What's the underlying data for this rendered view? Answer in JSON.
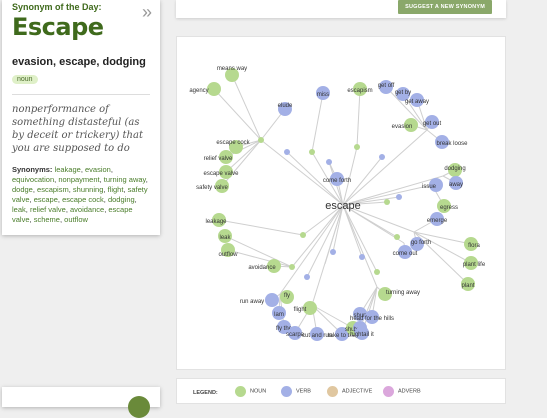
{
  "card": {
    "label": "Synonym of the Day:",
    "word": "Escape",
    "synonyms_line": "evasion, escape, dodging",
    "pos": "noun",
    "definition": "nonperformance of something distasteful (as by deceit or trickery) that you are supposed to do",
    "synonyms_heading": "Synonyms:",
    "synonyms": [
      "leakage",
      "evasion",
      "equivocation",
      "nonpayment",
      "turning away",
      "dodge",
      "escapism",
      "shunning",
      "flight",
      "safety valve",
      "escape",
      "escape cock",
      "dodging",
      "leak",
      "relief valve",
      "avoidance",
      "escape valve",
      "scheme",
      "outflow"
    ]
  },
  "top_panel": {
    "suggest_label": "SUGGEST A NEW SYNONYM"
  },
  "graph": {
    "colors": {
      "noun": "#b6d98f",
      "verb": "#a3b0e6",
      "adjective": "#e0c7a0",
      "adverb": "#dba7dc",
      "edge": "#cfcfcf",
      "hub": "#d2e4b6"
    },
    "center": "escape",
    "hubs": [
      "come forth",
      "escape",
      "evasion",
      "dodging",
      "issue",
      "come out",
      "go forth",
      "avoidance",
      "turning away",
      "flight",
      "run away"
    ],
    "nodes": [
      {
        "label": "means way",
        "pos": "noun"
      },
      {
        "label": "agency",
        "pos": "noun"
      },
      {
        "label": "elude",
        "pos": "verb"
      },
      {
        "label": "miss",
        "pos": "verb"
      },
      {
        "label": "escapism",
        "pos": "noun"
      },
      {
        "label": "get off",
        "pos": "verb"
      },
      {
        "label": "get by",
        "pos": "verb"
      },
      {
        "label": "get away",
        "pos": "verb"
      },
      {
        "label": "evasion",
        "pos": "noun"
      },
      {
        "label": "get out",
        "pos": "verb"
      },
      {
        "label": "break loose",
        "pos": "verb"
      },
      {
        "label": "escape cock",
        "pos": "noun"
      },
      {
        "label": "relief valve",
        "pos": "noun"
      },
      {
        "label": "escape valve",
        "pos": "noun"
      },
      {
        "label": "safety valve",
        "pos": "noun"
      },
      {
        "label": "come forth",
        "pos": "verb"
      },
      {
        "label": "dodging",
        "pos": "noun"
      },
      {
        "label": "issue",
        "pos": "verb"
      },
      {
        "label": "away",
        "pos": "verb"
      },
      {
        "label": "egress",
        "pos": "noun"
      },
      {
        "label": "emerge",
        "pos": "verb"
      },
      {
        "label": "leakage",
        "pos": "noun"
      },
      {
        "label": "leak",
        "pos": "noun"
      },
      {
        "label": "outflow",
        "pos": "noun"
      },
      {
        "label": "go forth",
        "pos": "verb"
      },
      {
        "label": "come out",
        "pos": "verb"
      },
      {
        "label": "flora",
        "pos": "noun"
      },
      {
        "label": "plant life",
        "pos": "noun"
      },
      {
        "label": "plant",
        "pos": "noun"
      },
      {
        "label": "avoidance",
        "pos": "noun"
      },
      {
        "label": "run away",
        "pos": "verb"
      },
      {
        "label": "fly",
        "pos": "noun"
      },
      {
        "label": "flight",
        "pos": "noun"
      },
      {
        "label": "turning away",
        "pos": "noun"
      },
      {
        "label": "shun",
        "pos": "verb"
      },
      {
        "label": "lam",
        "pos": "verb"
      },
      {
        "label": "fly the",
        "pos": "verb"
      },
      {
        "label": "scarpa",
        "pos": "verb"
      },
      {
        "label": "cut and run",
        "pos": "verb"
      },
      {
        "label": "take to the",
        "pos": "verb"
      },
      {
        "label": "shunn",
        "pos": "noun"
      },
      {
        "label": "head for the hills",
        "pos": "verb"
      },
      {
        "label": "bunk",
        "pos": "verb"
      },
      {
        "label": "hightail it",
        "pos": "verb"
      }
    ]
  },
  "legend": {
    "title": "LEGEND:",
    "items": [
      {
        "label": "NOUN",
        "color": "#b6d98f"
      },
      {
        "label": "VERB",
        "color": "#a3b0e6"
      },
      {
        "label": "ADJECTIVE",
        "color": "#e0c7a0"
      },
      {
        "label": "ADVERB",
        "color": "#dba7dc"
      }
    ]
  }
}
